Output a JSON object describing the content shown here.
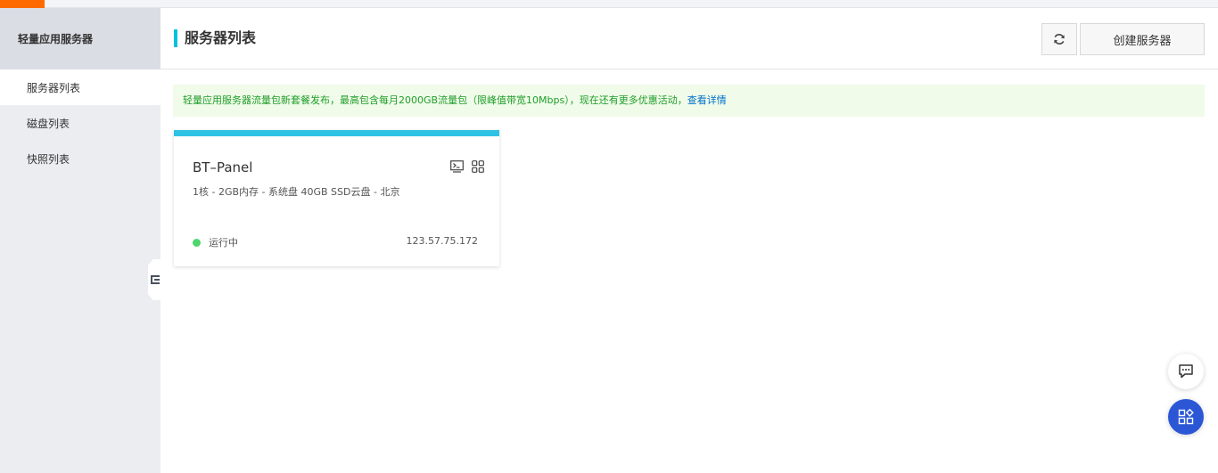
{
  "sidebar": {
    "title": "轻量应用服务器",
    "items": [
      {
        "label": "服务器列表"
      },
      {
        "label": "磁盘列表"
      },
      {
        "label": "快照列表"
      }
    ]
  },
  "header": {
    "title": "服务器列表",
    "create_label": "创建服务器"
  },
  "notice": {
    "text": "轻量应用服务器流量包新套餐发布，最高包含每月2000GB流量包（限峰值带宽10Mbps），现在还有更多优惠活动，",
    "link_label": "查看详情"
  },
  "servers": [
    {
      "name": "BT–Panel",
      "spec": "1核 - 2GB内存 - 系统盘 40GB SSD云盘 - 北京",
      "status": "运行中",
      "ip": "123.57.75.172"
    }
  ],
  "colors": {
    "accent": "#00c1de",
    "brand": "#ff6a00",
    "status_running": "#4fd66d",
    "notice_text": "#1f9e2a",
    "link": "#0070cc",
    "float_primary": "#2b56d6"
  },
  "icons": {
    "refresh": "refresh-icon",
    "terminal": "terminal-icon",
    "apps": "apps-icon",
    "chat": "chat-icon",
    "collapse": "collapse-sidebar-icon"
  }
}
